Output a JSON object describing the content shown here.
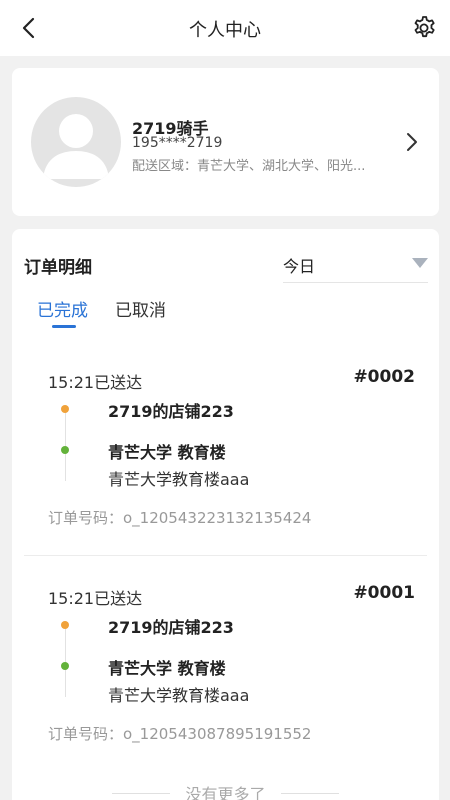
{
  "header": {
    "title": "个人中心",
    "back_icon": "back-chevron-icon",
    "settings_icon": "gear-icon"
  },
  "profile": {
    "name": "2719骑手",
    "phone": "195****2719",
    "area": "配送区域：青芒大学、湖北大学、阳光...",
    "avatar_icon": "avatar-placeholder-icon"
  },
  "orders": {
    "section_title": "订单明细",
    "date_filter": "今日",
    "tabs": [
      {
        "label": "已完成",
        "active": true
      },
      {
        "label": "已取消",
        "active": false
      }
    ],
    "list": [
      {
        "time": "15:21已送达",
        "number": "#0002",
        "shop": "2719的店铺223",
        "dest": "青芒大学 教育楼",
        "address": "青芒大学教育楼aaa",
        "order_no": "订单号码：o_120543223132135424"
      },
      {
        "time": "15:21已送达",
        "number": "#0001",
        "shop": "2719的店铺223",
        "dest": "青芒大学 教育楼",
        "address": "青芒大学教育楼aaa",
        "order_no": "订单号码：o_120543087895191552"
      }
    ],
    "footer": "没有更多了"
  },
  "colors": {
    "accent": "#2a73d6",
    "pickup_dot": "#f0a23a",
    "drop_dot": "#63b23a"
  }
}
